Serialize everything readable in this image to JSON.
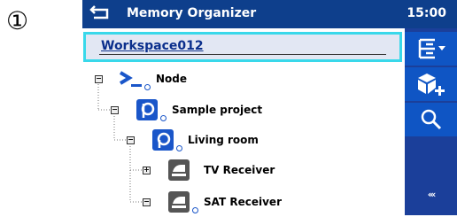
{
  "step_marker": "①",
  "titlebar": {
    "title": "Memory Organizer",
    "time": "15:00"
  },
  "workspace": {
    "name": "Workspace012"
  },
  "tree": [
    {
      "label": "Node",
      "toggle": "−",
      "icon": "node-icon",
      "level": 0
    },
    {
      "label": "Sample project",
      "toggle": "−",
      "icon": "project-icon",
      "level": 1
    },
    {
      "label": "Living room",
      "toggle": "−",
      "icon": "location-icon",
      "level": 2
    },
    {
      "label": "TV Receiver",
      "toggle": "+",
      "icon": "appliance-icon",
      "level": 3
    },
    {
      "label": "SAT Receiver",
      "toggle": "−",
      "icon": "appliance-icon",
      "level": 3
    }
  ],
  "sidebar": {
    "more_label": "‹‹‹"
  },
  "colors": {
    "title_bar": "#0e3f8c",
    "sidebar": "#1b3f9a",
    "button": "#0f55c4",
    "highlight": "#39d8ea"
  }
}
